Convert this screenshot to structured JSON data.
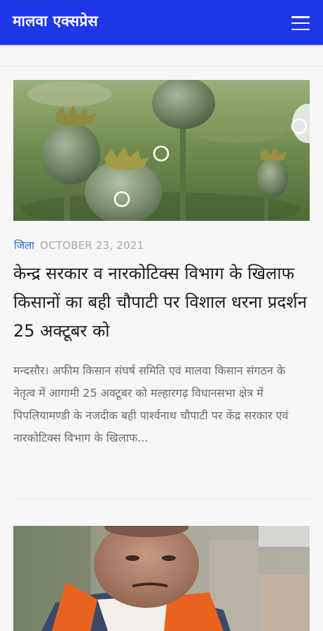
{
  "app": {
    "title": "मालवा एक्सप्रेस",
    "menu_icon": "hamburger-menu-icon",
    "accent_color": "#1f35e8"
  },
  "articles": [
    {
      "category": "जिला",
      "date": "OCTOBER 23, 2021",
      "headline": "केन्द्र सरकार व नारकोटिक्स विभाग के खिलाफ किसानों का बही चौपाटी पर विशाल धरना प्रदर्शन 25 अक्टूबर को",
      "excerpt": "मन्दसौर। अफीम किसान संघर्ष समिति एवं मालवा किसान संगठन के नेतृत्व में आगामी 25 अक्टूबर को मल्हारगढ़ विधानसभा क्षेत्र में पिपलियामण्डी के नजदीक बही पार्श्वनाथ चौपाटी पर केंद्र सरकार एवं नारकोटिक्स विभाग के खिलाफ...",
      "image": "opium-poppy-pods-photo"
    },
    {
      "image": "man-in-saffron-scarf-photo"
    }
  ]
}
